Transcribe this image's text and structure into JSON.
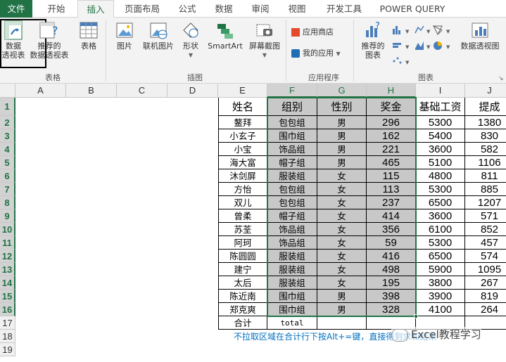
{
  "tabs": [
    "文件",
    "开始",
    "插入",
    "页面布局",
    "公式",
    "数据",
    "审阅",
    "视图",
    "开发工具",
    "POWER QUERY"
  ],
  "ribbon": {
    "pivot_table": "数据\n透视表",
    "pivot_table_l1": "数据",
    "pivot_table_l2": "透视表",
    "rec_pivot_l1": "推荐的",
    "rec_pivot_l2": "数据透视表",
    "table": "表格",
    "picture": "图片",
    "online_picture": "联机图片",
    "shapes": "形状",
    "smartart": "SmartArt",
    "screenshot": "屏幕截图",
    "app_store": "应用商店",
    "my_apps": "我的应用",
    "rec_charts_l1": "推荐的",
    "rec_charts_l2": "图表",
    "pivot_chart": "数据透视图",
    "groups": {
      "tables": "表格",
      "illustrations": "插图",
      "apps": "应用程序",
      "charts": "图表"
    }
  },
  "columns": [
    "A",
    "B",
    "C",
    "D",
    "E",
    "F",
    "G",
    "H",
    "I",
    "J"
  ],
  "rows": [
    "1",
    "2",
    "3",
    "4",
    "5",
    "6",
    "7",
    "8",
    "9",
    "10",
    "11",
    "12",
    "13",
    "14",
    "15",
    "16",
    "17",
    "18",
    "19"
  ],
  "table": {
    "headers": [
      "姓名",
      "组别",
      "性别",
      "奖金",
      "基础工资",
      "提成"
    ],
    "data": [
      [
        "鳌拜",
        "包包组",
        "男",
        "296",
        "5300",
        "1380"
      ],
      [
        "小玄子",
        "围巾组",
        "男",
        "162",
        "5400",
        "830"
      ],
      [
        "小宝",
        "饰品组",
        "男",
        "221",
        "3600",
        "582"
      ],
      [
        "海大富",
        "帽子组",
        "男",
        "465",
        "5100",
        "1106"
      ],
      [
        "沐剑屏",
        "服装组",
        "女",
        "115",
        "4800",
        "811"
      ],
      [
        "方怡",
        "包包组",
        "女",
        "113",
        "5300",
        "885"
      ],
      [
        "双儿",
        "包包组",
        "女",
        "237",
        "6500",
        "1207"
      ],
      [
        "曾柔",
        "帽子组",
        "女",
        "414",
        "3600",
        "571"
      ],
      [
        "苏荃",
        "饰品组",
        "女",
        "356",
        "6100",
        "852"
      ],
      [
        "阿珂",
        "饰品组",
        "女",
        "59",
        "5300",
        "457"
      ],
      [
        "陈圆圆",
        "服装组",
        "女",
        "416",
        "6500",
        "574"
      ],
      [
        "建宁",
        "服装组",
        "女",
        "498",
        "5900",
        "1095"
      ],
      [
        "太后",
        "服装组",
        "女",
        "195",
        "3800",
        "267"
      ],
      [
        "陈近南",
        "围巾组",
        "男",
        "398",
        "3900",
        "819"
      ],
      [
        "郑克爽",
        "围巾组",
        "男",
        "328",
        "4100",
        "264"
      ]
    ],
    "total_label": "合计",
    "total_value": "total"
  },
  "note": "不拉取区域在合计行下按Alt+=键，直接得到求和结果",
  "watermark": "Excel教程学习",
  "colors": {
    "excel_green": "#217346",
    "selection_fill": "#c8c8c8",
    "note_blue": "#0070c0"
  }
}
